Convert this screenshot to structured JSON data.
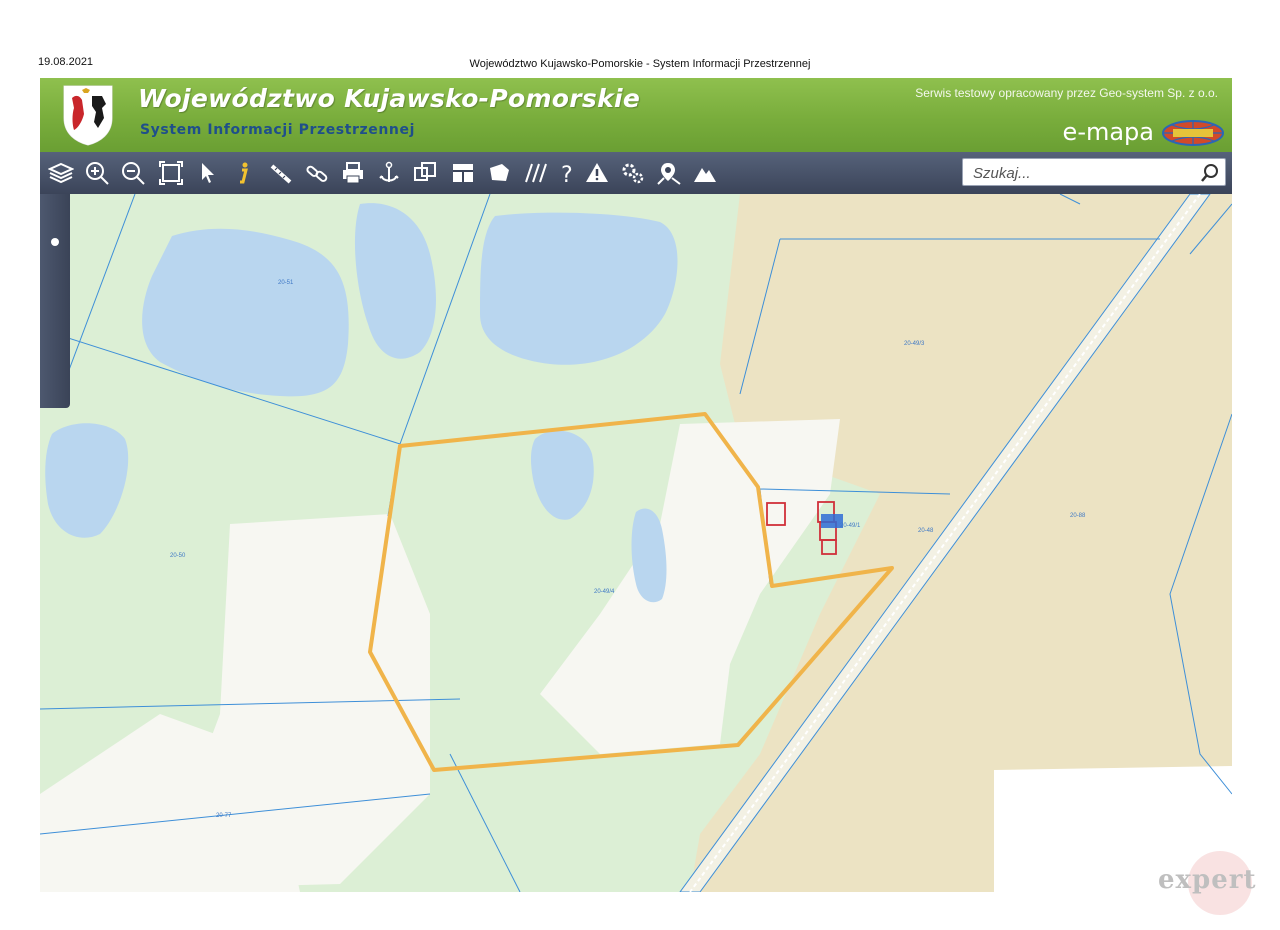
{
  "print": {
    "date": "19.08.2021",
    "title": "Województwo Kujawsko-Pomorskie - System Informacji Przestrzennej"
  },
  "header": {
    "title": "Województwo Kujawsko-Pomorskie",
    "subtitle": "System Informacji Przestrzennej",
    "credit": "Serwis testowy opracowany przez Geo-system Sp. z o.o.",
    "emapa": "e-mapa",
    "emapa_logo_text": "GEO-SYSTEM"
  },
  "toolbar": {
    "tools": [
      "layers-icon",
      "zoom-in-icon",
      "zoom-out-icon",
      "zoom-extent-icon",
      "select-pointer-icon",
      "info-icon",
      "measure-icon",
      "link-icon",
      "print-icon",
      "pan-icon",
      "compare-icon",
      "layout-icon",
      "polygon-icon",
      "hatch-icon",
      "help-icon",
      "warning-icon",
      "settings-icon",
      "location-icon",
      "terrain-icon"
    ],
    "search_placeholder": "Szukaj..."
  },
  "map": {
    "parcels": [
      {
        "label": "20-51"
      },
      {
        "label": "20-49/3"
      },
      {
        "label": "20-50"
      },
      {
        "label": "20-49/4"
      },
      {
        "label": "20-49/1"
      },
      {
        "label": "20-48"
      },
      {
        "label": "20-88"
      },
      {
        "label": "20-77"
      }
    ],
    "colors": {
      "meadow": "#dcefd5",
      "water": "#b9d6ef",
      "field": "#ece3c3",
      "builtup": "#f7f7f2",
      "boundary": "#3e8fd8",
      "selection": "#f0b44a",
      "building": "#d0303a"
    }
  },
  "watermark": "expert"
}
